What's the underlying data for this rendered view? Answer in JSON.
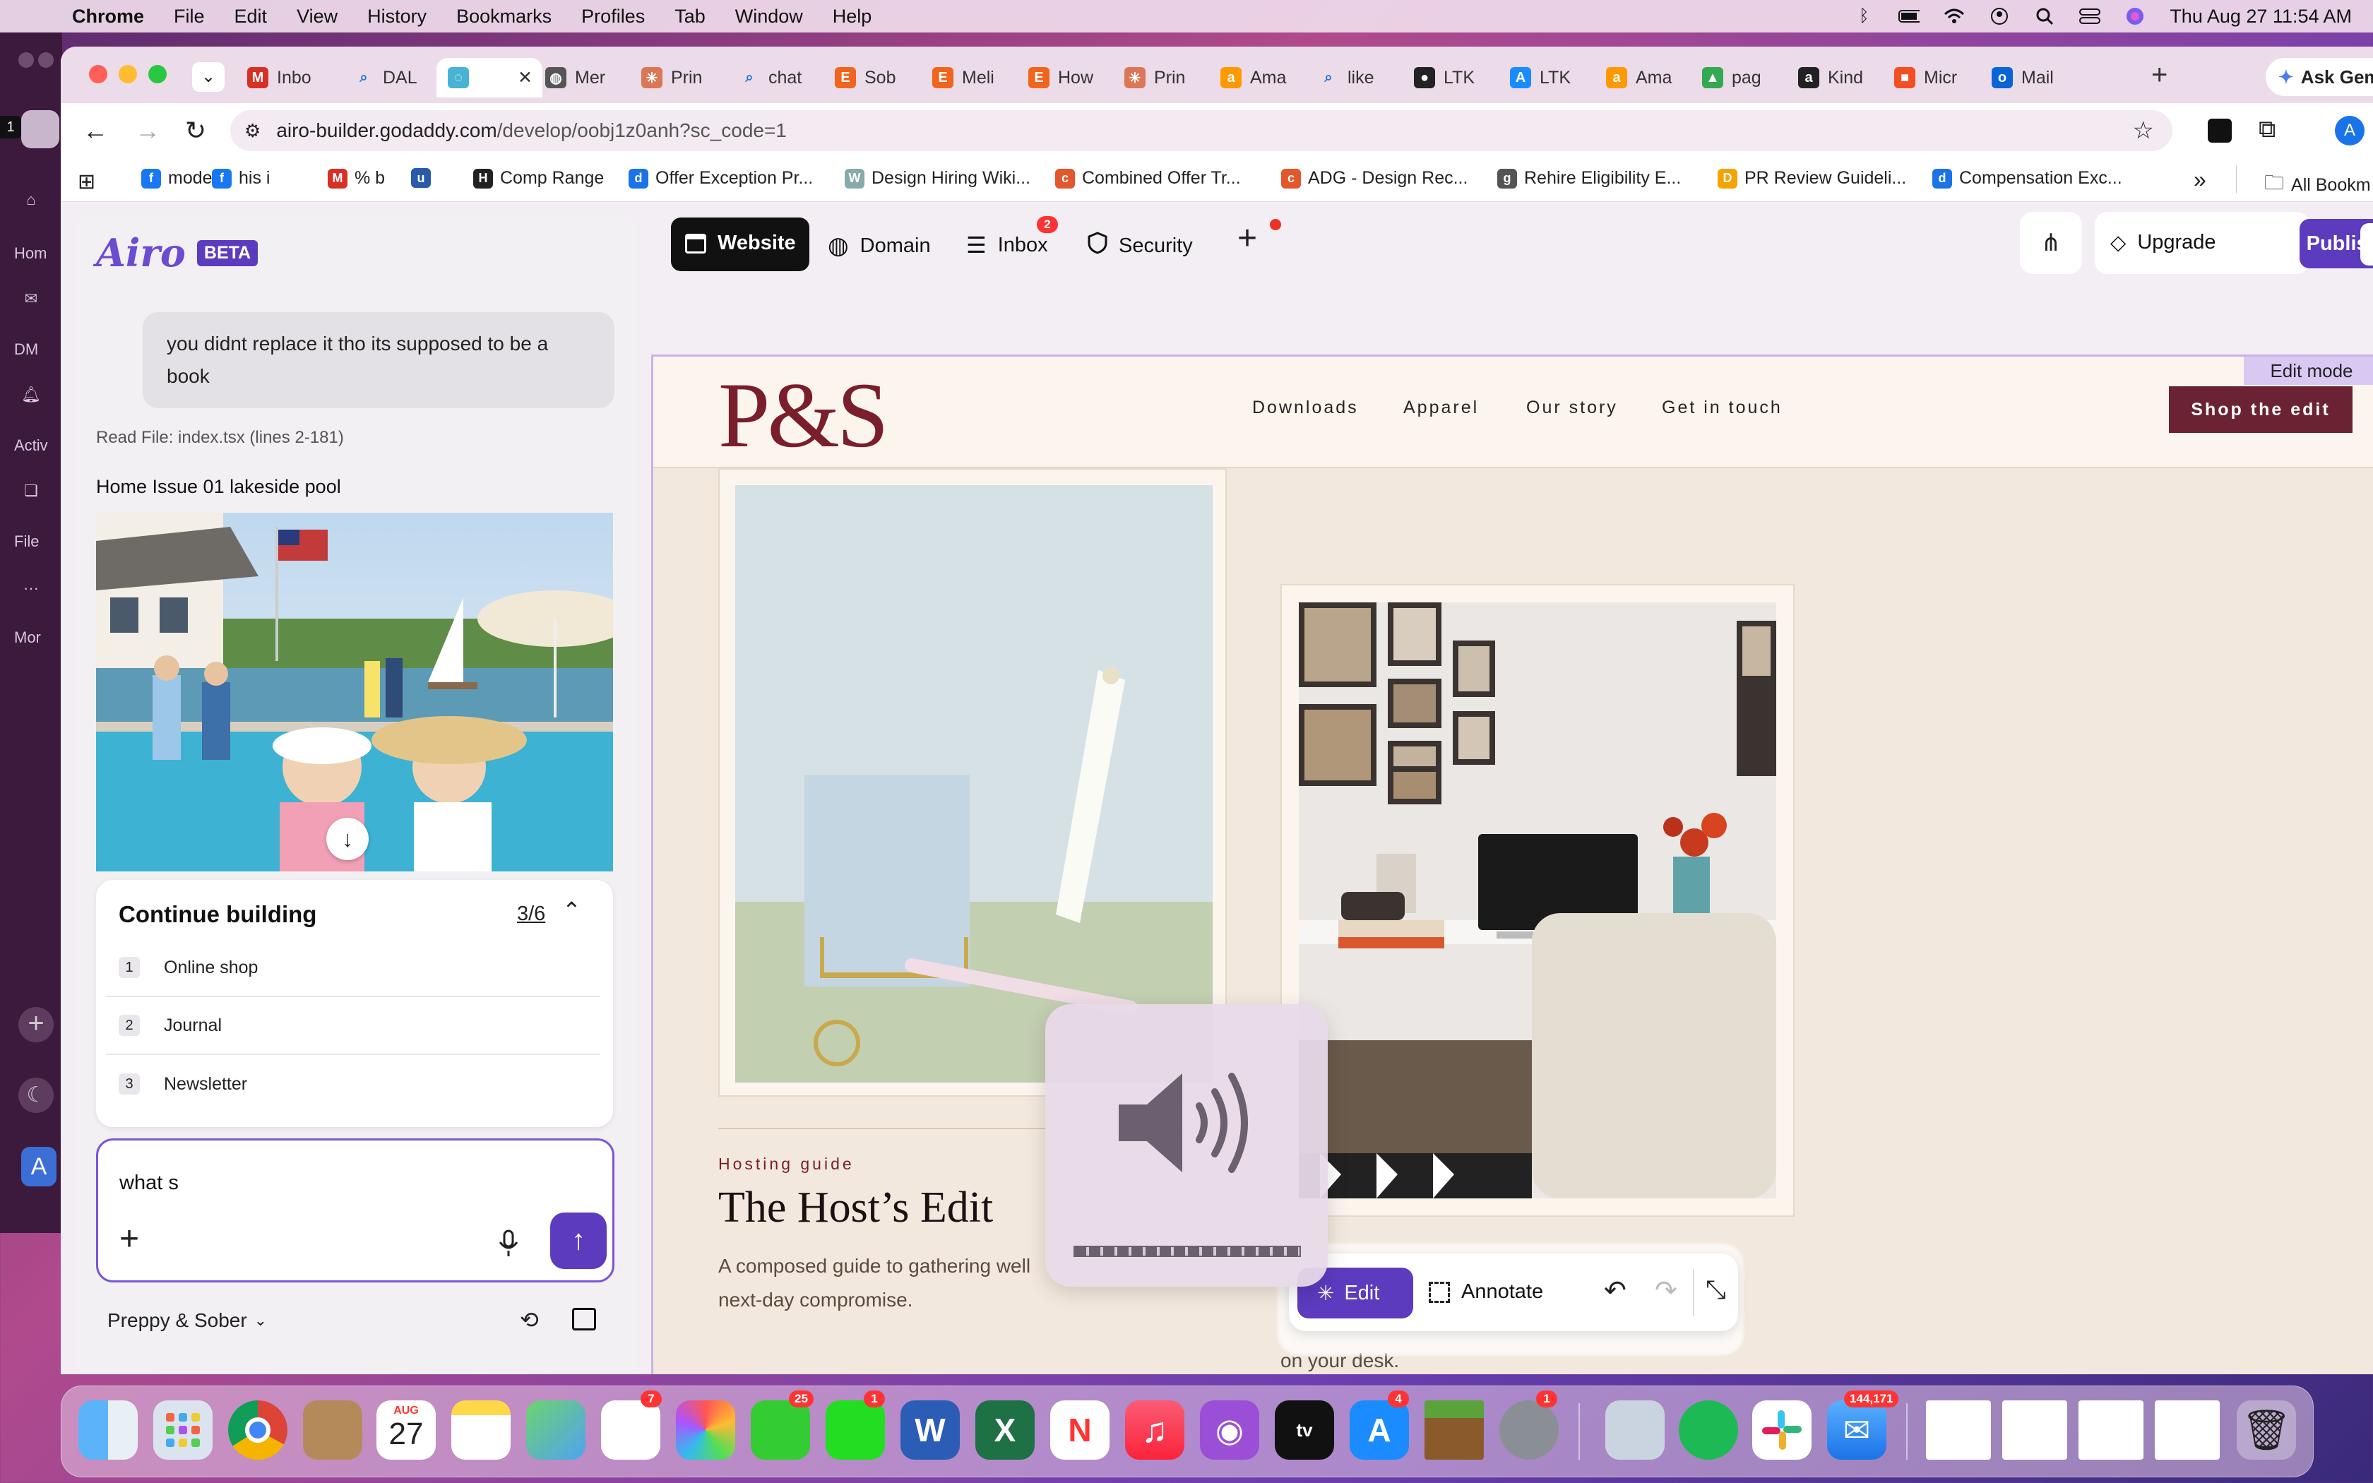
{
  "menubar": {
    "app": "Chrome",
    "items": [
      "File",
      "Edit",
      "View",
      "History",
      "Bookmarks",
      "Profiles",
      "Tab",
      "Window",
      "Help"
    ],
    "datetime": "Thu Aug 27  11:54 AM"
  },
  "slack": {
    "labels": [
      "Hom",
      "DM",
      "Activ",
      "File",
      "Mor"
    ],
    "badge": "1"
  },
  "tabs": [
    {
      "label": "Inbo",
      "icon": "M",
      "color": "#d93025"
    },
    {
      "label": "DAL",
      "icon": "search",
      "color": "#1a73e8"
    },
    {
      "label": "",
      "icon": "airo",
      "color": "#49b3d6",
      "active": true
    },
    {
      "label": "Mer",
      "icon": "globe",
      "color": "#555"
    },
    {
      "label": "Prin",
      "icon": "claude",
      "color": "#d97757"
    },
    {
      "label": "chat",
      "icon": "search",
      "color": "#1a73e8"
    },
    {
      "label": "Sob",
      "icon": "E",
      "color": "#f1641e"
    },
    {
      "label": "Meli",
      "icon": "E",
      "color": "#f1641e"
    },
    {
      "label": "How",
      "icon": "E",
      "color": "#f1641e"
    },
    {
      "label": "Prin",
      "icon": "claude",
      "color": "#d97757"
    },
    {
      "label": "Ama",
      "icon": "a",
      "color": "#ff9900"
    },
    {
      "label": "like",
      "icon": "search",
      "color": "#1a73e8"
    },
    {
      "label": "LTK",
      "icon": "gh",
      "color": "#222"
    },
    {
      "label": "LTK",
      "icon": "A",
      "color": "#1a8cff"
    },
    {
      "label": "Ama",
      "icon": "a",
      "color": "#ff9900"
    },
    {
      "label": "pag",
      "icon": "drive",
      "color": "#34a853"
    },
    {
      "label": "Kind",
      "icon": "a",
      "color": "#222"
    },
    {
      "label": "Micr",
      "icon": "ms",
      "color": "#f25022"
    },
    {
      "label": "Mail",
      "icon": "o",
      "color": "#0a64d6"
    }
  ],
  "ask_gemini": "Ask Gem",
  "address": {
    "domain": "airo-builder.godaddy.com",
    "path": "/develop/oobj1z0anh?sc_code=1",
    "avatar": "A"
  },
  "bookmarks": [
    {
      "label": "mode",
      "icon": "f",
      "color": "#1877f2"
    },
    {
      "label": "his i",
      "icon": "f",
      "color": "#1877f2"
    },
    {
      "label": "% b",
      "icon": "M",
      "color": "#d93025"
    },
    {
      "label": "",
      "icon": "u",
      "color": "#2b5aa8"
    },
    {
      "label": "Comp Range",
      "icon": "H",
      "color": "#222"
    },
    {
      "label": "Offer Exception Pr...",
      "icon": "d",
      "color": "#1a73e8"
    },
    {
      "label": "Design Hiring Wiki...",
      "icon": "W",
      "color": "#8aa"
    },
    {
      "label": "Combined Offer Tr...",
      "icon": "c",
      "color": "#e2572c"
    },
    {
      "label": "ADG - Design Rec...",
      "icon": "c",
      "color": "#e2572c"
    },
    {
      "label": "Rehire Eligibility E...",
      "icon": "g",
      "color": "#555"
    },
    {
      "label": "PR Review Guideli...",
      "icon": "D",
      "color": "#f4a300"
    },
    {
      "label": "Compensation Exc...",
      "icon": "d",
      "color": "#1a73e8"
    }
  ],
  "all_bookmarks": "All Bookm",
  "airo": {
    "logo": "Airo",
    "beta": "BETA",
    "user_message": "you didnt replace it tho its supposed to be a book",
    "read_file": "Read File: index.tsx (lines 2-181)",
    "image_caption": "Home Issue 01 lakeside pool",
    "continue_title": "Continue building",
    "progress": "3/6",
    "steps": [
      {
        "n": "1",
        "label": "Online shop"
      },
      {
        "n": "2",
        "label": "Journal"
      },
      {
        "n": "3",
        "label": "Newsletter"
      }
    ],
    "input_value": "what s",
    "site_name": "Preppy & Sober"
  },
  "editor": {
    "tabs": [
      {
        "label": "Website",
        "icon": "website-icon"
      },
      {
        "label": "Domain",
        "icon": "globe-icon"
      },
      {
        "label": "Inbox",
        "icon": "inbox-icon",
        "badge": "2"
      },
      {
        "label": "Security",
        "icon": "shield-icon"
      }
    ],
    "upgrade": "Upgrade",
    "publish": "Publish",
    "edit_mode": "Edit mode"
  },
  "site": {
    "logo": "P&S",
    "nav": [
      "Downloads",
      "Apparel",
      "Our story",
      "Get in touch"
    ],
    "cta": "Shop the edit",
    "eyebrow": "Hosting guide",
    "title": "The Host’s Edit",
    "body": "A composed guide to gathering well next-day compromise.",
    "body_line1": "A composed guide to gathering well",
    "body_line2": "next-day compromise.",
    "partial": "on your desk."
  },
  "floating_toolbar": {
    "edit": "Edit",
    "annotate": "Annotate"
  },
  "volume": {
    "level": 1.0
  },
  "dock": {
    "calendar_month": "AUG",
    "calendar_day": "27",
    "badges": {
      "reminders": "7",
      "messages": "25",
      "facetime": "1",
      "appstore": "4",
      "settings": "1",
      "mail": "144,171"
    }
  },
  "colors": {
    "accent": "#5c3bbf",
    "brand": "#7a1e2c",
    "cta": "#6b2232"
  }
}
